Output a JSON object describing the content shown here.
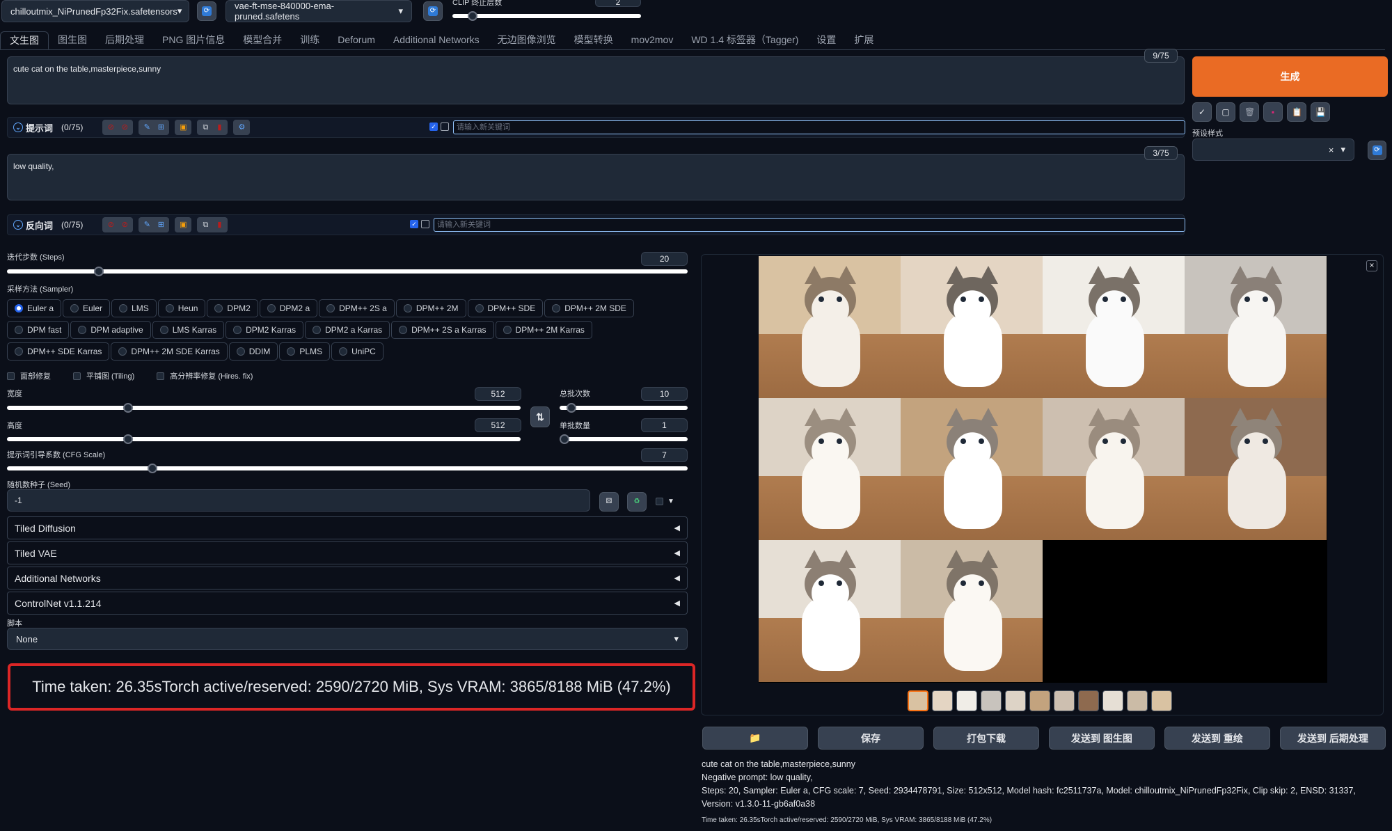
{
  "top": {
    "model": "chilloutmix_NiPrunedFp32Fix.safetensors",
    "vae": "vae-ft-mse-840000-ema-pruned.safetens",
    "clip_label": "CLIP 终止层数",
    "clip_value": "2"
  },
  "tabs": [
    "文生图",
    "图生图",
    "后期处理",
    "PNG 图片信息",
    "模型合并",
    "训练",
    "Deforum",
    "Additional Networks",
    "无边图像浏览",
    "模型转换",
    "mov2mov",
    "WD 1.4 标签器（Tagger)",
    "设置",
    "扩展"
  ],
  "prompt": {
    "text": "cute cat on the table,masterpiece,sunny",
    "counter": "9/75",
    "bar_title": "提示词",
    "bar_count": "(0/75)",
    "kw_placeholder": "请输入新关键词"
  },
  "negative": {
    "text": "low quality,",
    "counter": "3/75",
    "bar_title": "反向词",
    "bar_count": "(0/75)",
    "kw_placeholder": "请输入新关键词"
  },
  "generate": {
    "label": "生成",
    "tool_icons": [
      "check-icon",
      "square-icon",
      "trash-icon",
      "pink-card-icon",
      "clipboard-icon",
      "save-style-icon"
    ],
    "styles_label": "预设样式",
    "styles_clear": "×"
  },
  "steps": {
    "label": "迭代步数 (Steps)",
    "value": "20",
    "fraction": 0.13
  },
  "sampler": {
    "label": "采样方法 (Sampler)",
    "selected": "Euler a",
    "rows": [
      [
        "Euler a",
        "Euler",
        "LMS",
        "Heun",
        "DPM2",
        "DPM2 a",
        "DPM++ 2S a",
        "DPM++ 2M",
        "DPM++ SDE",
        "DPM++ 2M SDE"
      ],
      [
        "DPM fast",
        "DPM adaptive",
        "LMS Karras",
        "DPM2 Karras",
        "DPM2 a Karras",
        "DPM++ 2S a Karras",
        "DPM++ 2M Karras"
      ],
      [
        "DPM++ SDE Karras",
        "DPM++ 2M SDE Karras",
        "DDIM",
        "PLMS",
        "UniPC"
      ]
    ]
  },
  "checks": [
    "面部修复",
    "平铺图 (Tiling)",
    "高分辨率修复 (Hires. fix)"
  ],
  "width": {
    "label": "宽度",
    "value": "512",
    "fraction": 0.23
  },
  "height": {
    "label": "高度",
    "value": "512",
    "fraction": 0.23
  },
  "batch_count": {
    "label": "总批次数",
    "value": "10",
    "fraction": 0.06
  },
  "batch_size": {
    "label": "单批数量",
    "value": "1",
    "fraction": 0.0
  },
  "cfg": {
    "label": "提示词引导系数 (CFG Scale)",
    "value": "7",
    "fraction": 0.21
  },
  "seed": {
    "label": "随机数种子 (Seed)",
    "value": "-1"
  },
  "accordions": [
    "Tiled Diffusion",
    "Tiled VAE",
    "Additional Networks",
    "ControlNet v1.1.214"
  ],
  "script": {
    "label": "脚本",
    "value": "None"
  },
  "time_banner": "Time taken: 26.35sTorch active/reserved: 2590/2720 MiB, Sys VRAM: 3865/8188 MiB (47.2%)",
  "gallery": {
    "close": "×",
    "thumb_count": 11
  },
  "gallery_buttons": [
    "保存",
    "打包下载",
    "发送到 图生图",
    "发送到 重绘",
    "发送到 后期处理"
  ],
  "info": {
    "line1": "cute cat on the table,masterpiece,sunny",
    "line2": "Negative prompt: low quality,",
    "line3": "Steps: 20, Sampler: Euler a, CFG scale: 7, Seed: 2934478791, Size: 512x512, Model hash: fc2511737a, Model: chilloutmix_NiPrunedFp32Fix, Clip skip: 2, ENSD: 31337, Version: v1.3.0-11-gb6af0a38",
    "time": "Time taken: 26.35sTorch active/reserved: 2590/2720 MiB, Sys VRAM: 3865/8188 MiB (47.2%)"
  },
  "colors": {
    "accent": "#ea6b24",
    "banner_border": "#dc2626",
    "selected": "#2563eb"
  }
}
